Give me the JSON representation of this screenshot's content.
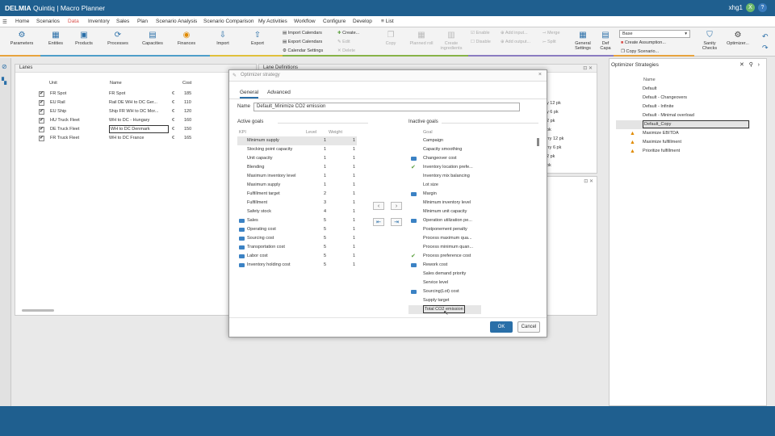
{
  "app": {
    "brand": "DELMIA",
    "title": "Quintiq | Macro Planner",
    "user": "xhg1",
    "user_initial": "X",
    "user_icon": "help-icon"
  },
  "menu": [
    "Home",
    "Scenarios",
    "Data",
    "Inventory",
    "Sales",
    "Plan",
    "Scenario Analysis",
    "Scenario Comparison",
    "My Activities",
    "Workflow",
    "Configure",
    "Develop",
    "List"
  ],
  "ribbon": {
    "parameters": "Parameters",
    "entities": "Entities",
    "products": "Products",
    "processes": "Processes",
    "capacities": "Capacities",
    "finances": "Finances",
    "import": "Import",
    "export": "Export",
    "import_calendars": "Import Calendars",
    "export_calendars": "Export Calendars",
    "calendar_settings": "Calendar Settings",
    "create": "Create...",
    "edit": "Edit",
    "delete": "Delete",
    "copy": "Copy",
    "planned_roll": "Planned roll",
    "create_ingredients": "Create ingredients",
    "enable": "Enable",
    "disable": "Disable",
    "add_input": "Add input...",
    "add_output": "Add output...",
    "merge": "Merge",
    "split": "Split",
    "general_settings": "General Settings",
    "def_capa": "Def Capa",
    "scenario_base": "Base",
    "create_assumption": "Create Assumption...",
    "copy_scenario": "Copy Scenario...",
    "sanity_checks": "Sanity Checks",
    "optimizer": "Optimizer..."
  },
  "lanes": {
    "title": "Lanes",
    "headers": {
      "unit": "Unit",
      "name": "Name",
      "cost": "Cost"
    },
    "rows": [
      {
        "unit": "FR Spot",
        "name": "FR Spot",
        "cur": "€",
        "cost": "185"
      },
      {
        "unit": "EU Rail",
        "name": "Rail DE WH to DC Ger...",
        "cur": "€",
        "cost": "110"
      },
      {
        "unit": "EU Ship",
        "name": "Ship FR WH to DC Mor...",
        "cur": "€",
        "cost": "120"
      },
      {
        "unit": "HU Truck Fleet",
        "name": "WH to DC - Hungary",
        "cur": "€",
        "cost": "160"
      },
      {
        "unit": "DE Truck Fleet",
        "name": "WH to DC Denmark",
        "cur": "€",
        "cost": "150"
      },
      {
        "unit": "FR Truck Fleet",
        "name": "WH to DC France",
        "cur": "€",
        "cost": "165"
      }
    ]
  },
  "lane_defs": {
    "title": "Lane Definitions",
    "values": [
      "y 12 pk",
      "y 6 pk",
      "2 pk",
      "pk",
      "rry 12 pk",
      "rry 6 pk",
      "2 pk",
      "pk"
    ]
  },
  "dialog": {
    "title": "Optimizer strategy",
    "tab_general": "General",
    "tab_advanced": "Advanced",
    "name_label": "Name",
    "name_value": "Default_Minimize CO2 emission",
    "active_title": "Active goals",
    "active_headers": {
      "kpi": "KPI",
      "level": "Level",
      "weight": "Weight"
    },
    "active_goals": [
      {
        "kpi": "Minimum supply",
        "level": "1",
        "weight": "1",
        "icon": false
      },
      {
        "kpi": "Stocking point capacity",
        "level": "1",
        "weight": "1",
        "icon": false
      },
      {
        "kpi": "Unit capacity",
        "level": "1",
        "weight": "1",
        "icon": false
      },
      {
        "kpi": "Blending",
        "level": "1",
        "weight": "1",
        "icon": false
      },
      {
        "kpi": "Maximum inventory level",
        "level": "1",
        "weight": "1",
        "icon": false
      },
      {
        "kpi": "Maximum supply",
        "level": "1",
        "weight": "1",
        "icon": false
      },
      {
        "kpi": "Fulfillment target",
        "level": "2",
        "weight": "1",
        "icon": false
      },
      {
        "kpi": "Fulfillment",
        "level": "3",
        "weight": "1",
        "icon": false
      },
      {
        "kpi": "Safety stock",
        "level": "4",
        "weight": "1",
        "icon": false
      },
      {
        "kpi": "Sales",
        "level": "5",
        "weight": "1",
        "icon": true
      },
      {
        "kpi": "Operating cost",
        "level": "5",
        "weight": "1",
        "icon": true
      },
      {
        "kpi": "Sourcing cost",
        "level": "5",
        "weight": "1",
        "icon": true
      },
      {
        "kpi": "Transportation cost",
        "level": "5",
        "weight": "1",
        "icon": true
      },
      {
        "kpi": "Labor cost",
        "level": "5",
        "weight": "1",
        "icon": true
      },
      {
        "kpi": "Inventory holding cost",
        "level": "5",
        "weight": "1",
        "icon": true
      }
    ],
    "inactive_title": "Inactive goals",
    "inactive_header": "Goal",
    "inactive_goals": [
      {
        "goal": "Campaign",
        "mark": ""
      },
      {
        "goal": "Capacity smoothing",
        "mark": ""
      },
      {
        "goal": "Changeover cost",
        "mark": "money"
      },
      {
        "goal": "Inventory location prefe...",
        "mark": "check"
      },
      {
        "goal": "Inventory mix balancing",
        "mark": ""
      },
      {
        "goal": "Lot size",
        "mark": ""
      },
      {
        "goal": "Margin",
        "mark": "money"
      },
      {
        "goal": "Minimum inventory level",
        "mark": ""
      },
      {
        "goal": "Minimum unit capacity",
        "mark": ""
      },
      {
        "goal": "Operation utilization pe...",
        "mark": "money"
      },
      {
        "goal": "Postponement penalty",
        "mark": ""
      },
      {
        "goal": "Process maximum qua...",
        "mark": ""
      },
      {
        "goal": "Process minimum quan...",
        "mark": ""
      },
      {
        "goal": "Process preference cost",
        "mark": "check"
      },
      {
        "goal": "Rework cost",
        "mark": "money"
      },
      {
        "goal": "Sales demand priority",
        "mark": ""
      },
      {
        "goal": "Service level",
        "mark": ""
      },
      {
        "goal": "Sourcing(Lot) cost",
        "mark": "money"
      },
      {
        "goal": "Supply target",
        "mark": ""
      },
      {
        "goal": "Total CO2 emission",
        "mark": ""
      }
    ],
    "ok": "OK",
    "cancel": "Cancel"
  },
  "strategies": {
    "title": "Optimizer Strategies",
    "header": "Name",
    "items": [
      {
        "name": "Default",
        "warn": false,
        "selected": false
      },
      {
        "name": "Default - Changeovers",
        "warn": false,
        "selected": false
      },
      {
        "name": "Default - Infinite",
        "warn": false,
        "selected": false
      },
      {
        "name": "Default - Minimal overload",
        "warn": false,
        "selected": false
      },
      {
        "name": "Default_Copy",
        "warn": false,
        "selected": true
      },
      {
        "name": "Maximize EBITDA",
        "warn": true,
        "selected": false
      },
      {
        "name": "Maximize fulfillment",
        "warn": true,
        "selected": false
      },
      {
        "name": "Prioritize fulfillment",
        "warn": true,
        "selected": false
      }
    ]
  },
  "colors": {
    "brand": "#1f5f8f",
    "accent": "#2a6fa8",
    "menu_active": "#d9534f"
  }
}
